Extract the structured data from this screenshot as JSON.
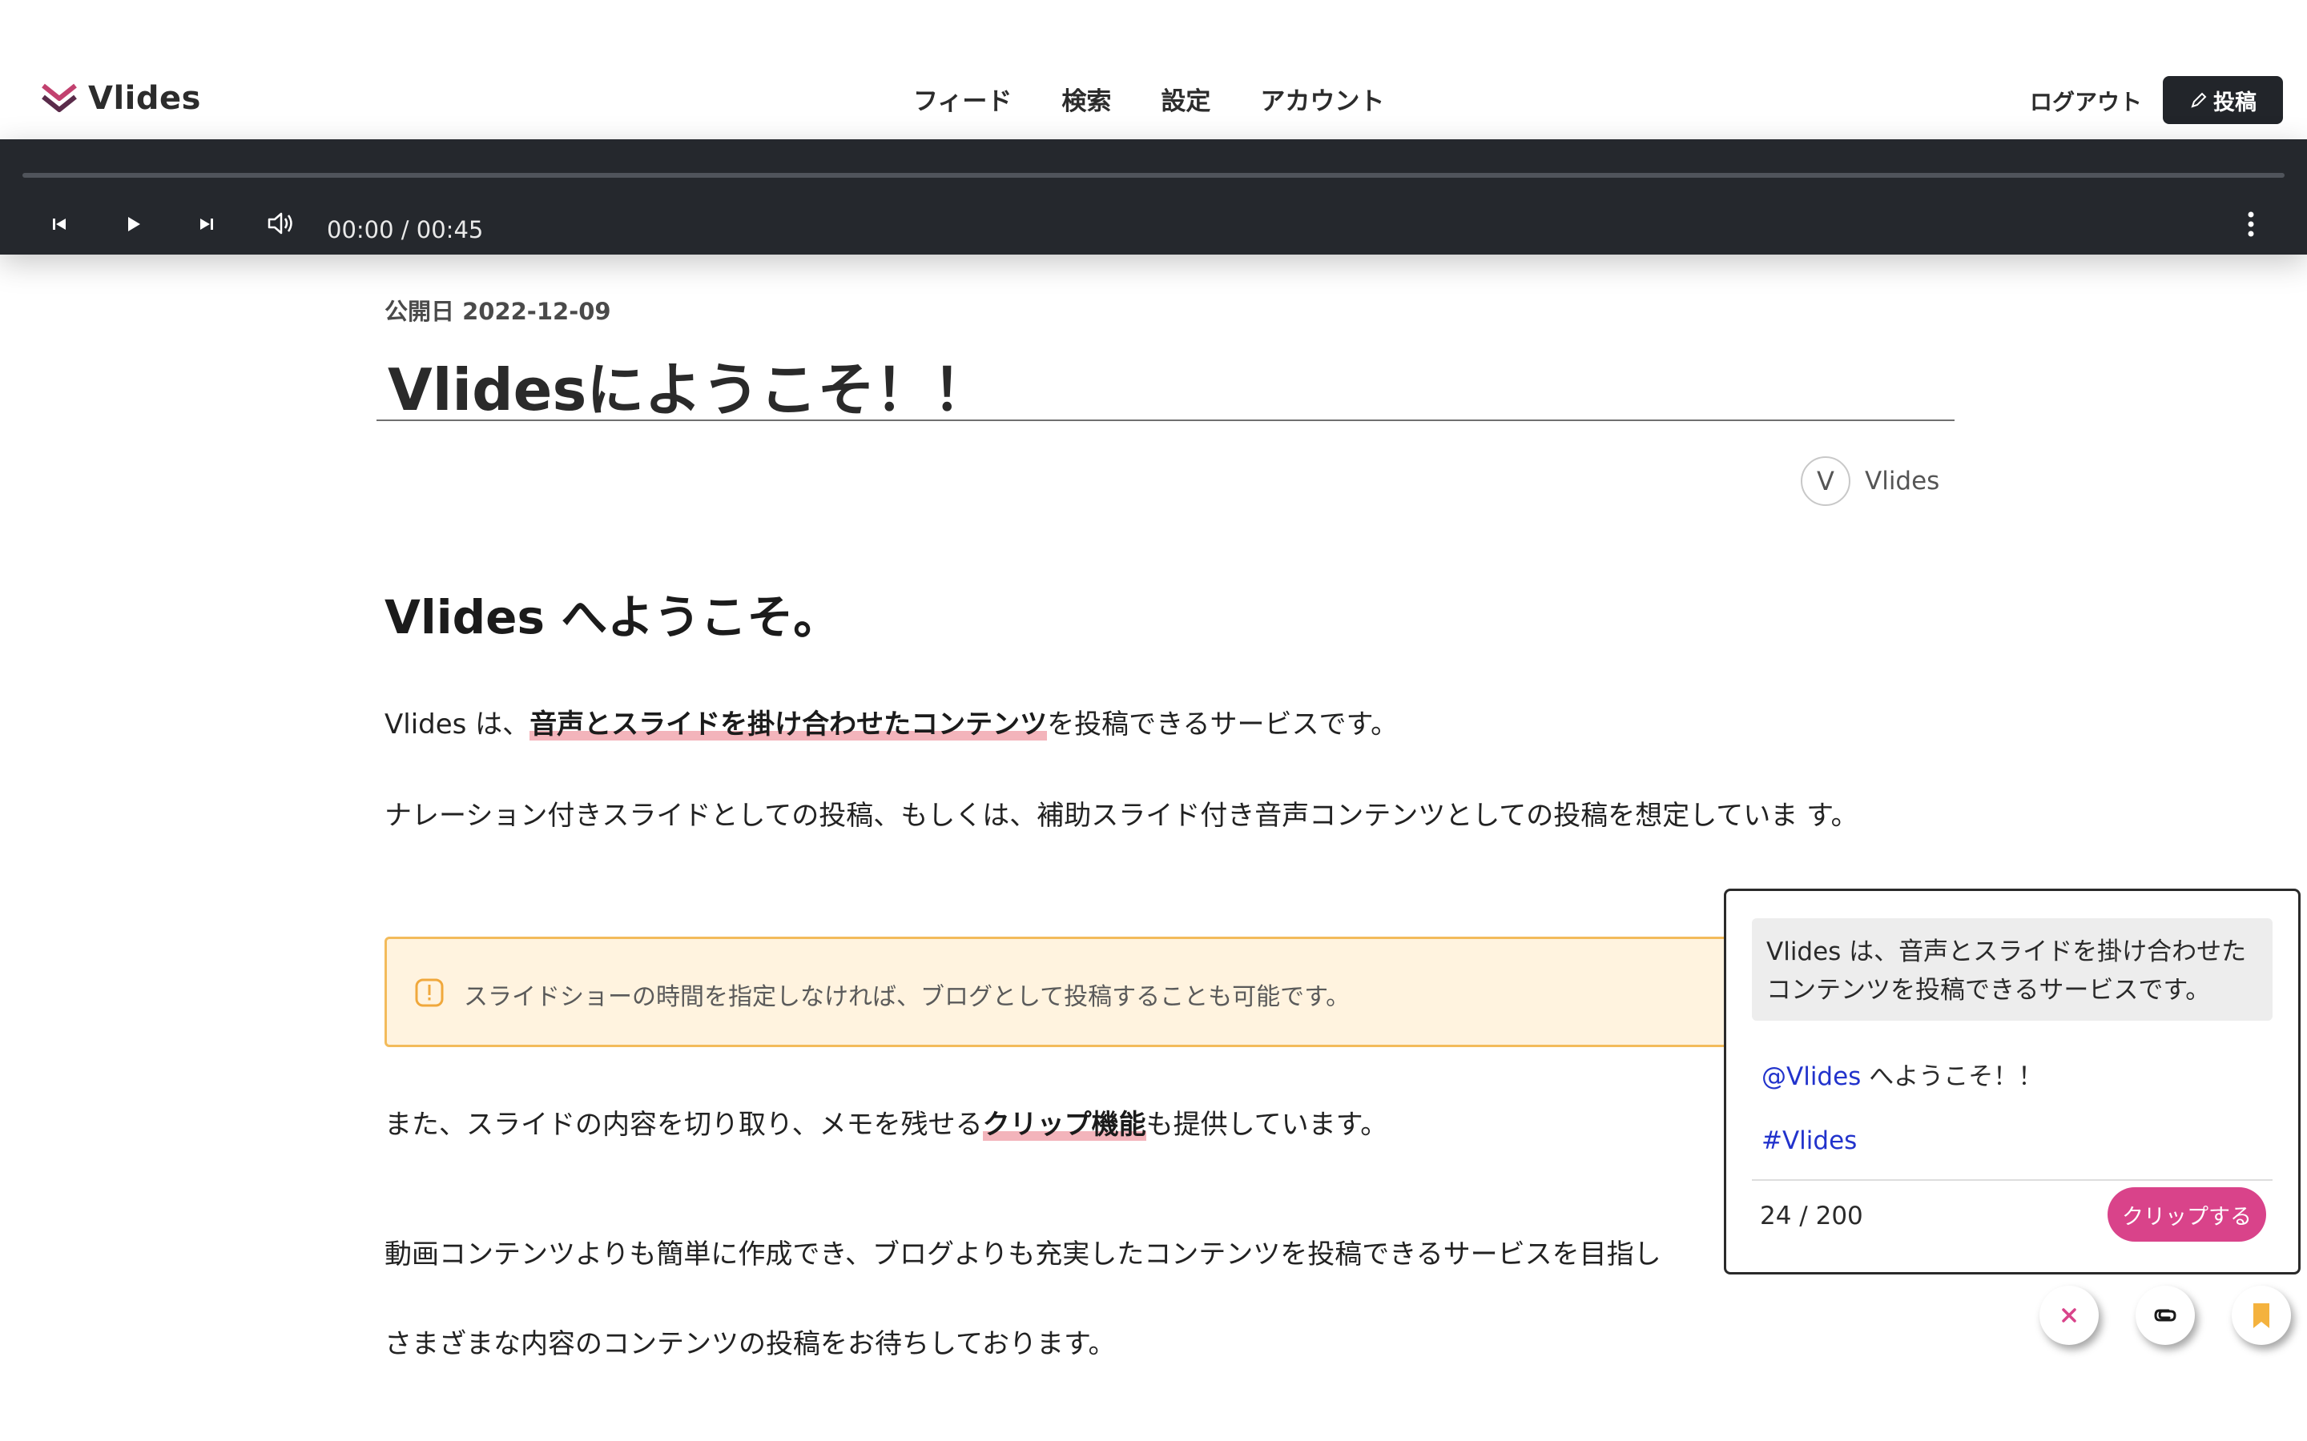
{
  "header": {
    "brand": "Vlides",
    "nav": [
      "フィード",
      "検索",
      "設定",
      "アカウント"
    ],
    "logout": "ログアウト",
    "post": "投稿"
  },
  "player": {
    "time": "00:00 / 00:45"
  },
  "article": {
    "published": "公開日 2022-12-09",
    "title": "Vlidesにようこそ！！",
    "author_initial": "V",
    "author_name": "Vlides",
    "heading": "Vlides へようこそ。",
    "p1_pre": "Vlides は、",
    "p1_hl": "音声とスライドを掛け合わせたコンテンツ",
    "p1_post": "を投稿できるサービスです。",
    "p2": "ナレーション付きスライドとしての投稿、もしくは、補助スライド付き音声コンテンツとしての投稿を想定していま す。",
    "alert": "スライドショーの時間を指定しなければ、ブログとして投稿することも可能です。",
    "p3_pre": "また、スライドの内容を切り取り、メモを残せる",
    "p3_hl": "クリップ機能",
    "p3_post": "も提供しています。",
    "p4": "動画コンテンツよりも簡単に作成でき、ブログよりも充実したコンテンツを投稿できるサービスを目指し",
    "p5": "さまざまな内容のコンテンツの投稿をお待ちしております。"
  },
  "clip": {
    "quote": "Vlides は、音声とスライドを掛け合わせたコンテンツを投稿できるサービスです。",
    "mention": "@Vlides",
    "mention_text": " へようこそ！！",
    "hashtag": "#Vlides",
    "count": "24 / 200",
    "button": "クリップする"
  },
  "colors": {
    "accent": "#d9438a",
    "player_bg": "#25282d",
    "alert_bg": "#fff3df",
    "alert_border": "#f3bb5a",
    "highlight": "#f3b4bb",
    "link": "#2233cc"
  }
}
